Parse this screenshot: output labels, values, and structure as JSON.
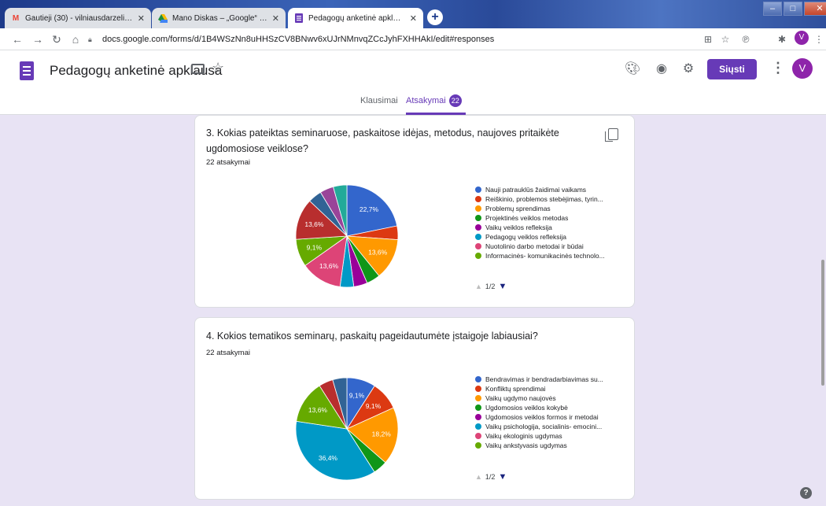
{
  "browser": {
    "tabs": [
      {
        "title": "Gautieji (30) - vilniausdarzelis.vai",
        "favicon": "gmail-icon",
        "active": false
      },
      {
        "title": "Mano Diskas – „Google“ diskas\"",
        "favicon": "drive-icon",
        "active": false
      },
      {
        "title": "Pedagogų anketinė apklausa - „C",
        "favicon": "forms-icon",
        "active": true
      }
    ],
    "new_tab": "+",
    "url": "docs.google.com/forms/d/1B4WSzNn8uHHSzCV8BNwv6xUJrNMnvqZCcJyhFXHHAkI/edit#responses",
    "profile_initial": "V"
  },
  "form": {
    "title": "Pedagogų anketinė apklausa",
    "send_label": "Siųsti",
    "avatar_initial": "V",
    "tabs": {
      "questions": "Klausimai",
      "responses": "Atsakymai",
      "responses_count": "22"
    },
    "accent": "#673ab7"
  },
  "cards": [
    {
      "question_line1": "3. Kokias pateiktas seminaruose, paskaitose idėjas, metodus, naujoves pritaikėte",
      "question_line2": "ugdomosiose veiklose?",
      "responses": "22 atsakymai",
      "pager": "1/2",
      "chart_data": {
        "type": "pie",
        "legend": [
          {
            "label": "Nauji patrauklūs žaidimai vaikams",
            "color": "#3366cc"
          },
          {
            "label": "Reiškinio, problemos stebėjimas, tyrin...",
            "color": "#dc3912"
          },
          {
            "label": "Problemų sprendimas",
            "color": "#ff9900"
          },
          {
            "label": "Projektinės veiklos metodas",
            "color": "#109618"
          },
          {
            "label": "Vaikų veiklos refleksija",
            "color": "#990099"
          },
          {
            "label": "Pedagogų veiklos refleksija",
            "color": "#0099c6"
          },
          {
            "label": "Nuotolinio darbo metodai ir būdai",
            "color": "#dd4477"
          },
          {
            "label": "Informacinės- komunikacinės technolo...",
            "color": "#66aa00"
          }
        ],
        "slices": [
          {
            "value": 22.7,
            "color": "#3366cc",
            "label": "22,7%"
          },
          {
            "value": 4.5,
            "color": "#dc3912",
            "label": ""
          },
          {
            "value": 13.6,
            "color": "#ff9900",
            "label": "13,6%"
          },
          {
            "value": 4.5,
            "color": "#109618",
            "label": ""
          },
          {
            "value": 4.5,
            "color": "#990099",
            "label": ""
          },
          {
            "value": 4.5,
            "color": "#0099c6",
            "label": ""
          },
          {
            "value": 13.6,
            "color": "#dd4477",
            "label": "13,6%"
          },
          {
            "value": 9.1,
            "color": "#66aa00",
            "label": "9,1%"
          },
          {
            "value": 13.6,
            "color": "#b82e2e",
            "label": "13,6%"
          },
          {
            "value": 4.5,
            "color": "#316395",
            "label": ""
          },
          {
            "value": 4.5,
            "color": "#994499",
            "label": ""
          },
          {
            "value": 4.5,
            "color": "#22aa99",
            "label": ""
          }
        ]
      }
    },
    {
      "question_line1": "4. Kokios tematikos seminarų, paskaitų pageidautumėte įstaigoje labiausiai?",
      "question_line2": "",
      "responses": "22 atsakymai",
      "pager": "1/2",
      "chart_data": {
        "type": "pie",
        "legend": [
          {
            "label": "Bendravimas ir bendradarbiavimas su...",
            "color": "#3366cc"
          },
          {
            "label": "Konfliktų sprendimai",
            "color": "#dc3912"
          },
          {
            "label": "Vaikų ugdymo naujovės",
            "color": "#ff9900"
          },
          {
            "label": "Ugdomosios veiklos kokybė",
            "color": "#109618"
          },
          {
            "label": "Ugdomosios veiklos formos ir metodai",
            "color": "#990099"
          },
          {
            "label": "Vaikų psichologija, socialinis- emocini...",
            "color": "#0099c6"
          },
          {
            "label": "Vaikų ekologinis ugdymas",
            "color": "#dd4477"
          },
          {
            "label": "Vaikų ankstyvasis ugdymas",
            "color": "#66aa00"
          }
        ],
        "slices": [
          {
            "value": 9.1,
            "color": "#3366cc",
            "label": "9,1%"
          },
          {
            "value": 9.1,
            "color": "#dc3912",
            "label": "9,1%"
          },
          {
            "value": 18.2,
            "color": "#ff9900",
            "label": "18,2%"
          },
          {
            "value": 4.5,
            "color": "#109618",
            "label": ""
          },
          {
            "value": 36.4,
            "color": "#0099c6",
            "label": "36,4%"
          },
          {
            "value": 13.6,
            "color": "#66aa00",
            "label": "13,6%"
          },
          {
            "value": 4.5,
            "color": "#b82e2e",
            "label": ""
          },
          {
            "value": 4.5,
            "color": "#316395",
            "label": ""
          }
        ]
      }
    }
  ]
}
